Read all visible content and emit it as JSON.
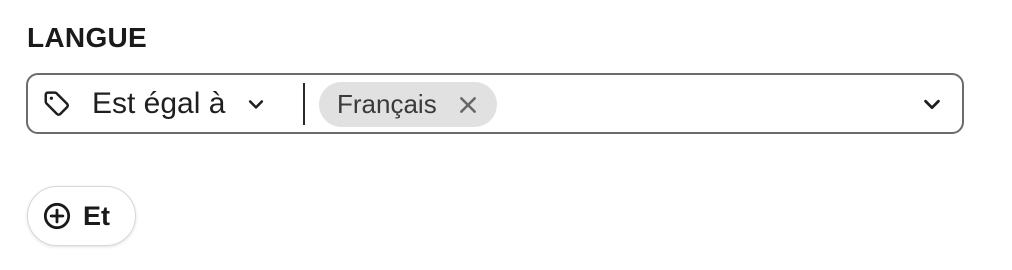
{
  "filter": {
    "label": "LANGUE",
    "operator": {
      "icon": "tag-icon",
      "label": "Est égal à"
    },
    "values": [
      {
        "label": "Français",
        "remove_icon": "close-icon"
      }
    ],
    "dropdown_icon": "chevron-down-icon"
  },
  "add_condition": {
    "icon": "plus-circle-icon",
    "label": "Et"
  },
  "colors": {
    "border": "#6b6b6b",
    "chip_background": "#e1e1e1",
    "text": "#1f1f1f"
  }
}
